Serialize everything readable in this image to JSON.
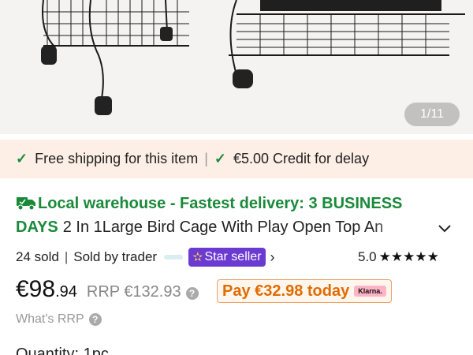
{
  "gallery": {
    "counter": "1/11"
  },
  "shipping_banner": {
    "free_shipping": "Free shipping for this item",
    "separator": "|",
    "credit": "€5.00 Credit for delay"
  },
  "title": {
    "delivery": "Local warehouse - Fastest delivery: 3 BUSINESS",
    "delivery_cont": "DAYS",
    "product_name": "2 In 1Large Bird Cage With Play Open Top An"
  },
  "seller": {
    "sold_count": "24 sold",
    "separator": "|",
    "sold_by": "Sold by trader",
    "badge": "Star seller",
    "rating": "5.0",
    "stars": "★★★★★"
  },
  "price": {
    "currency_main": "€98",
    "cents": ".94",
    "rrp": "RRP €132.93",
    "pay_today": "Pay €32.98 today",
    "klarna": "Klarna."
  },
  "whats_rrp": "What's RRP",
  "quantity": "Quantity: 1pc",
  "colors": {
    "accent_green": "#1a8a3a",
    "banner_bg": "#fdefe6",
    "star_badge": "#6b3bd1",
    "pay_orange": "#e26b00",
    "klarna_pink": "#ffb3c7"
  }
}
